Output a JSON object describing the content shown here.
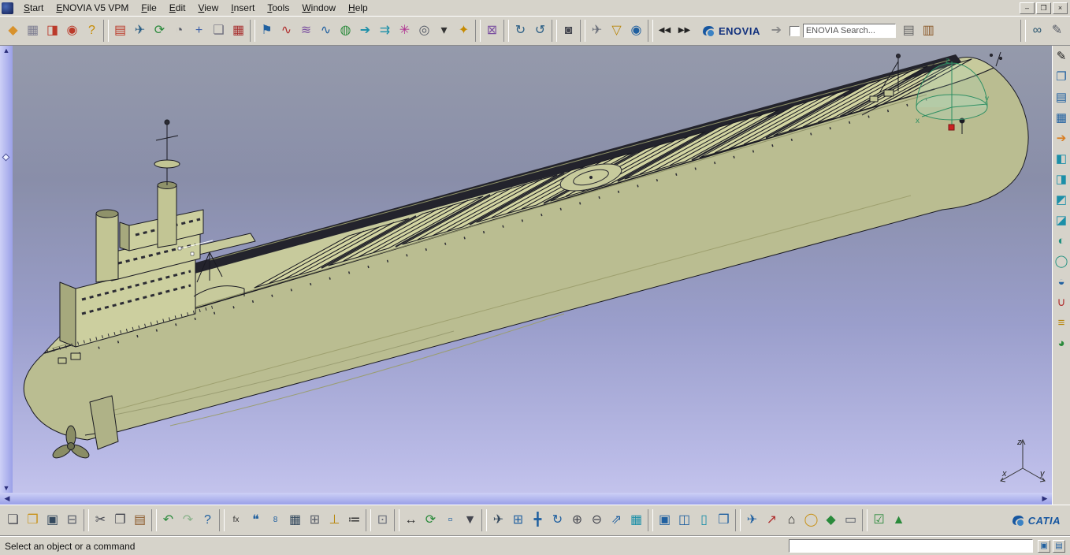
{
  "menu": {
    "items": [
      {
        "name": "menu-start",
        "label": "Start"
      },
      {
        "name": "menu-enovia-v5-vpm",
        "label": "ENOVIA V5 VPM"
      },
      {
        "name": "menu-file",
        "label": "File"
      },
      {
        "name": "menu-edit",
        "label": "Edit"
      },
      {
        "name": "menu-view",
        "label": "View"
      },
      {
        "name": "menu-insert",
        "label": "Insert"
      },
      {
        "name": "menu-tools",
        "label": "Tools"
      },
      {
        "name": "menu-window",
        "label": "Window"
      },
      {
        "name": "menu-help",
        "label": "Help"
      }
    ]
  },
  "window_controls": [
    {
      "name": "minimize-button",
      "glyph": "–"
    },
    {
      "name": "maximize-button",
      "glyph": "❒"
    },
    {
      "name": "close-button",
      "glyph": "×"
    }
  ],
  "top_toolbar": {
    "logo_text": "ENOVIA",
    "search": {
      "value": "ENOVIA Search..."
    },
    "icons": [
      {
        "name": "enovia-home-icon",
        "glyph": "◆",
        "color": "#d8922c"
      },
      {
        "name": "product-structure-icon",
        "glyph": "▦",
        "color": "#7d7d91"
      },
      {
        "name": "vehicle-icon",
        "glyph": "◨",
        "color": "#bb3a2a"
      },
      {
        "name": "vehicle-query-icon",
        "glyph": "◉",
        "color": "#bb3a2a"
      },
      {
        "name": "help-icon",
        "glyph": "?",
        "color": "#c68a00"
      },
      {
        "sep": true
      },
      {
        "name": "report-chart-icon",
        "glyph": "▤",
        "color": "#bb3a2a"
      },
      {
        "name": "airplane-icon",
        "glyph": "✈",
        "color": "#2a5e85"
      },
      {
        "name": "refresh-icon",
        "glyph": "⟳",
        "color": "#2a8a3b"
      },
      {
        "name": "clock-icon",
        "glyph": "◔",
        "color": "#555a66"
      },
      {
        "name": "axis-system-icon",
        "glyph": "+",
        "color": "#3a5fa8"
      },
      {
        "name": "bounding-box-icon",
        "glyph": "❏",
        "color": "#6d6d7d"
      },
      {
        "name": "table-red-icon",
        "glyph": "▦",
        "color": "#a83030"
      },
      {
        "sep": true
      },
      {
        "name": "flag-icon",
        "glyph": "⚑",
        "color": "#2060a0"
      },
      {
        "name": "wave-red-icon",
        "glyph": "∿",
        "color": "#b03030"
      },
      {
        "name": "surface-waves-icon",
        "glyph": "≋",
        "color": "#7a4fa0"
      },
      {
        "name": "wave-blue-icon",
        "glyph": "∿",
        "color": "#2060a0"
      },
      {
        "name": "globe-mesh-icon",
        "glyph": "◍",
        "color": "#2a8a3b"
      },
      {
        "name": "arrow-teal-icon",
        "glyph": "➔",
        "color": "#1b8fa8"
      },
      {
        "name": "double-arrow-icon",
        "glyph": "⇉",
        "color": "#1b8fa8"
      },
      {
        "name": "star-burst-icon",
        "glyph": "✳",
        "color": "#b03090"
      },
      {
        "name": "search-annotation-icon",
        "glyph": "◎",
        "color": "#555a66"
      },
      {
        "name": "dropdown-more-icon",
        "glyph": "▾",
        "color": "#333333"
      },
      {
        "name": "pin-light-icon",
        "glyph": "✦",
        "color": "#c68a00"
      },
      {
        "sep": true
      },
      {
        "name": "mesh-grid-icon",
        "glyph": "⊠",
        "color": "#7a4fa0"
      },
      {
        "sep": true
      },
      {
        "name": "rotate-cw-icon",
        "glyph": "↻",
        "color": "#2a5e85"
      },
      {
        "name": "rotate-ccw-icon",
        "glyph": "↺",
        "color": "#2a5e85"
      },
      {
        "sep": true
      },
      {
        "name": "camera-record-icon",
        "glyph": "◙",
        "color": "#44464f"
      },
      {
        "sep": true
      },
      {
        "name": "plane-locate-icon",
        "glyph": "✈",
        "color": "#6a6f7a"
      },
      {
        "name": "filter-funnel-icon",
        "glyph": "▽",
        "color": "#b8860b"
      },
      {
        "name": "compass-ball-icon",
        "glyph": "◉",
        "color": "#2060a0"
      },
      {
        "sep": true
      },
      {
        "name": "go-first-icon",
        "glyph": "◀◀",
        "color": "#222222",
        "small": true
      },
      {
        "name": "go-last-icon",
        "glyph": "▶▶",
        "color": "#222222",
        "small": true
      }
    ],
    "transfer_icon": {
      "name": "transfer-plane-icon",
      "glyph": "➔",
      "color": "#888888"
    },
    "tail_icons": [
      {
        "name": "search-list-icon",
        "glyph": "▤",
        "color": "#666666"
      },
      {
        "name": "library-books-icon",
        "glyph": "▥",
        "color": "#8b5a2b"
      }
    ],
    "far_icons": [
      {
        "name": "link-sync-icon",
        "glyph": "∞",
        "color": "#27546f"
      },
      {
        "name": "edit-query-icon",
        "glyph": "✎",
        "color": "#555a66"
      }
    ]
  },
  "right_toolbar": {
    "icons": [
      {
        "name": "exit-workbench-icon",
        "glyph": "✎",
        "color": "#1a1a1a"
      },
      {
        "name": "windows-stack-icon",
        "glyph": "❐",
        "color": "#2060a0"
      },
      {
        "name": "spec-sheet-icon",
        "glyph": "▤",
        "color": "#2060a0"
      },
      {
        "name": "grid-sheet-icon",
        "glyph": "▦",
        "color": "#2060a0"
      },
      {
        "name": "pointer-orange-icon",
        "glyph": "➔",
        "color": "#d87c20"
      },
      {
        "name": "view-front-icon",
        "glyph": "◧",
        "color": "#1b8fa8"
      },
      {
        "name": "view-side-icon",
        "glyph": "◨",
        "color": "#1b8fa8"
      },
      {
        "name": "view-top-icon",
        "glyph": "◩",
        "color": "#1b8fa8"
      },
      {
        "name": "view-iso-icon",
        "glyph": "◪",
        "color": "#1b8fa8"
      },
      {
        "name": "shading-mode-icon",
        "glyph": "◐",
        "color": "#1f9080"
      },
      {
        "name": "wireframe-mode-icon",
        "glyph": "◯",
        "color": "#1f9080"
      },
      {
        "name": "hide-show-icon",
        "glyph": "◒",
        "color": "#2060a0"
      },
      {
        "name": "clamp-icon",
        "glyph": "∪",
        "color": "#b03030"
      },
      {
        "name": "layers-icon",
        "glyph": "≡",
        "color": "#b8860b"
      },
      {
        "name": "graduated-ground-icon",
        "glyph": "◕",
        "color": "#2a8a3b"
      }
    ]
  },
  "bottom_toolbar": {
    "logo_text": "CATIA",
    "icons": [
      {
        "name": "new-document-icon",
        "glyph": "❏",
        "color": "#44464f"
      },
      {
        "name": "open-folder-icon",
        "glyph": "❒",
        "color": "#c8921a"
      },
      {
        "name": "save-icon",
        "glyph": "▣",
        "color": "#34495e"
      },
      {
        "name": "print-icon",
        "glyph": "⊟",
        "color": "#555a66"
      },
      {
        "sep": true
      },
      {
        "name": "cut-icon",
        "glyph": "✂",
        "color": "#44464f"
      },
      {
        "name": "copy-icon",
        "glyph": "❐",
        "color": "#44464f"
      },
      {
        "name": "paste-icon",
        "glyph": "▤",
        "color": "#8b5a2b"
      },
      {
        "sep": true
      },
      {
        "name": "undo-icon",
        "glyph": "↶",
        "color": "#2a8a3b"
      },
      {
        "name": "redo-icon",
        "glyph": "↷",
        "color": "#2a8a3b",
        "grayed": true
      },
      {
        "name": "whats-this-icon",
        "glyph": "?",
        "color": "#2060a0"
      },
      {
        "sep": true
      },
      {
        "name": "formula-icon",
        "glyph": "fx",
        "color": "#333333",
        "small": true
      },
      {
        "name": "comment-balloon-icon",
        "glyph": "❝",
        "color": "#2060a0"
      },
      {
        "name": "rule-number-icon",
        "glyph": "8",
        "color": "#2060a0",
        "small": true
      },
      {
        "name": "design-table-icon",
        "glyph": "▦",
        "color": "#34495e"
      },
      {
        "name": "relations-icon",
        "glyph": "⊞",
        "color": "#555a66"
      },
      {
        "name": "constraint-icon",
        "glyph": "⊥",
        "color": "#b8860b"
      },
      {
        "name": "parameters-icon",
        "glyph": "≔",
        "color": "#333333"
      },
      {
        "sep": true
      },
      {
        "name": "quick-print-icon",
        "glyph": "⊡",
        "color": "#6a6f7a"
      },
      {
        "sep": true
      },
      {
        "name": "measure-icon",
        "glyph": "↔",
        "color": "#333333"
      },
      {
        "name": "update-icon",
        "glyph": "⟳",
        "color": "#2a8a3b"
      },
      {
        "name": "part-box-icon",
        "glyph": "▫",
        "color": "#2060a0"
      },
      {
        "name": "inertia-icon",
        "glyph": "▼",
        "color": "#44464f"
      },
      {
        "sep": true
      },
      {
        "name": "fly-mode-icon",
        "glyph": "✈",
        "color": "#34495e"
      },
      {
        "name": "fit-all-icon",
        "glyph": "⊞",
        "color": "#2060a0"
      },
      {
        "name": "pan-icon",
        "glyph": "╋",
        "color": "#2060a0"
      },
      {
        "name": "rotate-view-icon",
        "glyph": "↻",
        "color": "#2060a0"
      },
      {
        "name": "zoom-in-icon",
        "glyph": "⊕",
        "color": "#44464f"
      },
      {
        "name": "zoom-out-icon",
        "glyph": "⊖",
        "color": "#44464f"
      },
      {
        "name": "normal-view-icon",
        "glyph": "⇗",
        "color": "#2060a0"
      },
      {
        "name": "quick-views-icon",
        "glyph": "▦",
        "color": "#1b8fa8"
      },
      {
        "sep": true
      },
      {
        "name": "new-window-icon",
        "glyph": "▣",
        "color": "#2060a0"
      },
      {
        "name": "look-at-icon",
        "glyph": "◫",
        "color": "#2060a0"
      },
      {
        "name": "dmu-clipboard-icon",
        "glyph": "▯",
        "color": "#1b8fa8"
      },
      {
        "name": "tile-windows-icon",
        "glyph": "❒",
        "color": "#2060a0"
      },
      {
        "sep": true
      },
      {
        "name": "publish-plane-icon",
        "glyph": "✈",
        "color": "#2060a0"
      },
      {
        "name": "red-vector-icon",
        "glyph": "↗",
        "color": "#b03030"
      },
      {
        "name": "section-cap-icon",
        "glyph": "⌂",
        "color": "#222222"
      },
      {
        "name": "yellow-ring-icon",
        "glyph": "◯",
        "color": "#c8921a"
      },
      {
        "name": "green-gem-icon",
        "glyph": "◆",
        "color": "#2a8a3b"
      },
      {
        "name": "frame-icon",
        "glyph": "▭",
        "color": "#555a66"
      },
      {
        "sep": true
      },
      {
        "name": "apply-check-icon",
        "glyph": "☑",
        "color": "#2a8a3b"
      },
      {
        "name": "performance-chart-icon",
        "glyph": "▲",
        "color": "#2a8a3b"
      }
    ]
  },
  "scroll": {
    "up": "▲",
    "down": "▼",
    "left": "◀",
    "right": "▶"
  },
  "status": {
    "message": "Select an object or a command"
  },
  "viewport": {
    "triad": {
      "x": "x",
      "y": "y",
      "z": "z"
    },
    "compass": {
      "x": "x",
      "y": "y",
      "z": "z"
    },
    "colors": {
      "bg_top": "#959aab",
      "bg_bottom": "#c3c3ec",
      "ship_deck": "#c7ca9c",
      "ship_hull": "#babd91",
      "hatch": "#d3d5a2",
      "bulwark": "#23232c",
      "compass_green": "#2f8f63",
      "compass_red": "#cc2222"
    }
  }
}
